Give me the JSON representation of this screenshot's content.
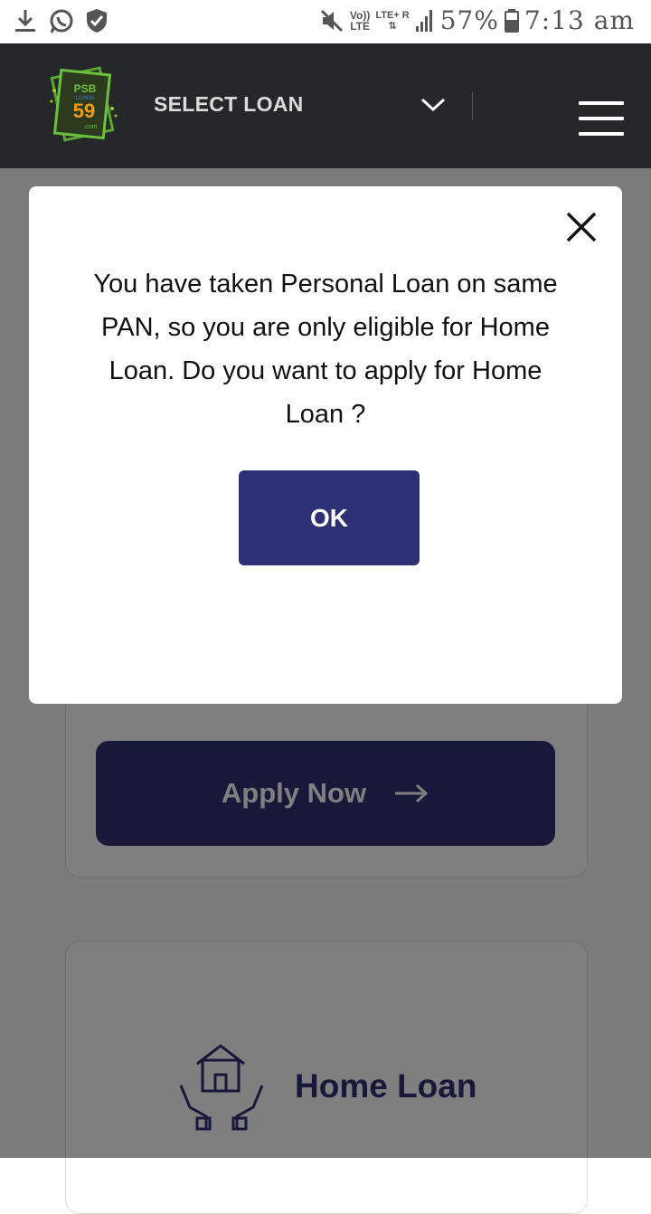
{
  "status_bar": {
    "volte": "Vo))",
    "lte": "LTE",
    "lte_plus": "LTE+ R",
    "battery": "57%",
    "time": "7:13 am"
  },
  "header": {
    "logo_top": "PSB",
    "logo_mid": "LOANS",
    "logo_num": "59",
    "logo_bottom": ".com",
    "select_label": "SELECT LOAN"
  },
  "modal": {
    "message": "You have taken Personal Loan on same PAN, so you are only eligible for Home Loan. Do you want to apply for Home Loan ?",
    "ok_label": "OK"
  },
  "cards": {
    "apply_label": "Apply Now",
    "home_loan_label": "Home Loan"
  },
  "colors": {
    "brand": "#2e3075",
    "navbar": "#262729"
  }
}
